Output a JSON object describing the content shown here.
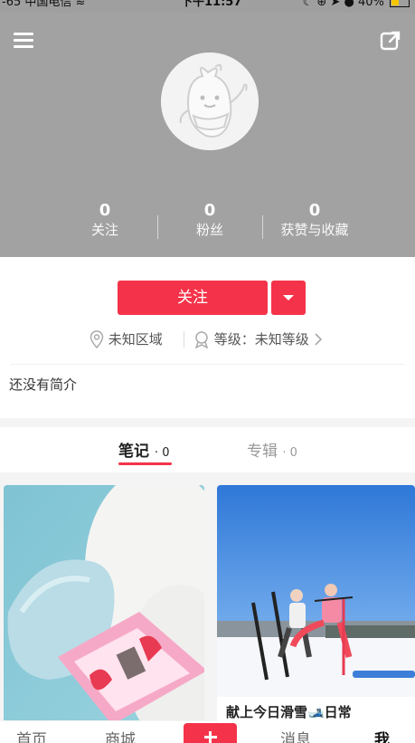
{
  "status_bar": {
    "carrier": "-65 中国电信",
    "time": "下午11:57",
    "battery": "40%",
    "battery_fill": 0.4
  },
  "header": {
    "menu_icon": "menu-icon",
    "share_icon": "share-icon",
    "avatar_icon": "default-avatar",
    "stats": [
      {
        "value": "0",
        "label": "关注"
      },
      {
        "value": "0",
        "label": "粉丝"
      },
      {
        "value": "0",
        "label": "获赞与收藏"
      }
    ]
  },
  "profile": {
    "follow_label": "关注",
    "location": "未知区域",
    "level": "等级：未知等级",
    "bio": "还没有简介"
  },
  "tabs": {
    "notes_label": "笔记",
    "notes_count": "0",
    "albums_label": "专辑",
    "albums_count": "0"
  },
  "feed": {
    "notes": [
      {
        "title": ""
      },
      {
        "title": "献上今日滑雪🎿日常"
      }
    ]
  },
  "bottom_nav": {
    "items": [
      "首页",
      "商城",
      "消息",
      "我"
    ],
    "active": "我"
  },
  "colors": {
    "accent": "#f4334a",
    "header_bg": "#a2a2a2"
  }
}
